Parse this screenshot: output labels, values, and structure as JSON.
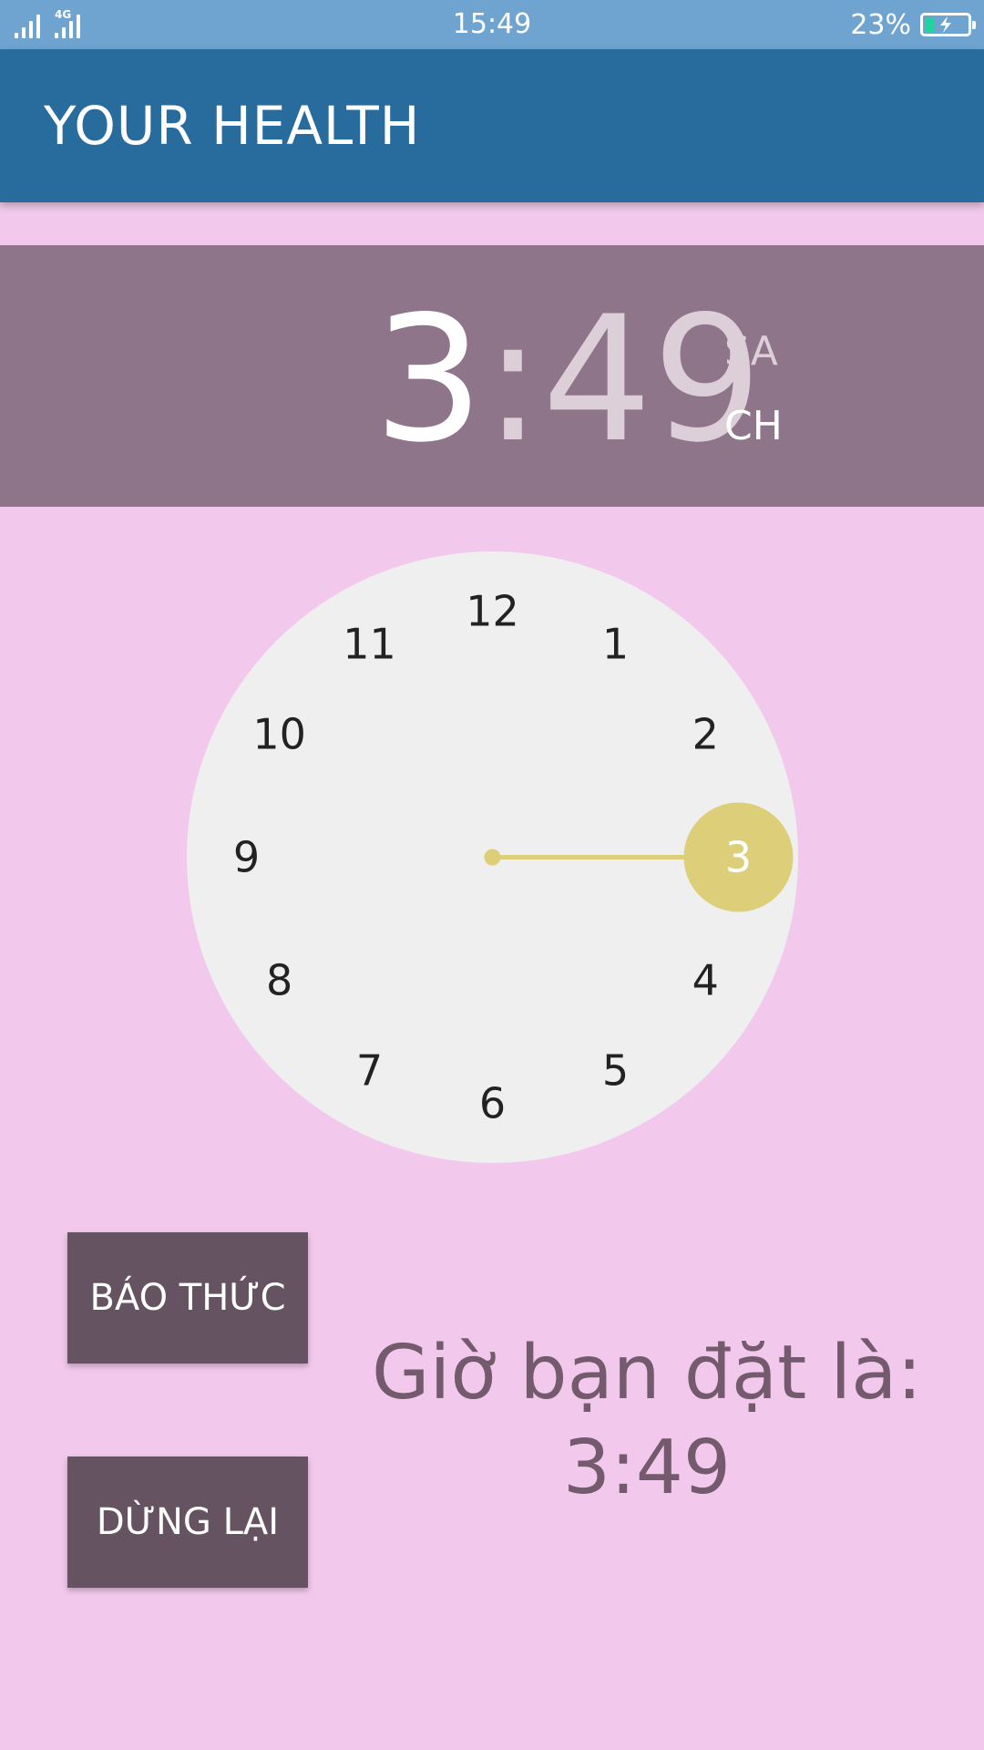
{
  "status_bar": {
    "network": "4G",
    "time": "15:49",
    "battery_percent": "23%",
    "battery_level": 0.23,
    "icons": [
      "signal-icon",
      "signal-4g-icon",
      "battery-charging-icon"
    ]
  },
  "app_bar": {
    "title": "YOUR HEALTH",
    "color": "#286C9E"
  },
  "time_picker": {
    "hour": "3",
    "separator": ":",
    "minute": "49",
    "am_label": "SA",
    "pm_label": "CH",
    "selected_period": "CH",
    "header_color": "#8F7589",
    "dial_numbers": [
      "12",
      "1",
      "2",
      "3",
      "4",
      "5",
      "6",
      "7",
      "8",
      "9",
      "10",
      "11"
    ],
    "selected_number": "3",
    "selector_color": "#DDCE79",
    "dial_color": "#EFEFEF"
  },
  "buttons": {
    "alarm_label": "BÁO THỨC",
    "stop_label": "DỪNG LẠI",
    "color": "#665361"
  },
  "set_time": {
    "line1": "Giờ bạn đặt là:",
    "line2": "3:49"
  }
}
